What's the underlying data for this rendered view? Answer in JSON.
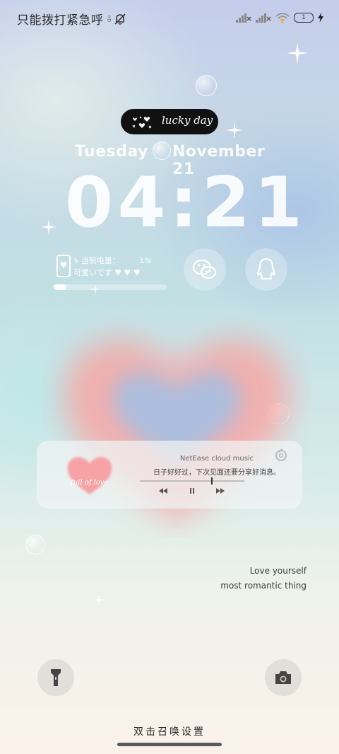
{
  "status_bar": {
    "carrier_text": "只能拨打紧急呼",
    "hd_tag": "HD",
    "battery_level": "1",
    "icons": [
      "mute-bell-icon",
      "signal-x-icon",
      "signal-x-icon",
      "wifi-icon",
      "battery-icon",
      "charging-bolt-icon"
    ]
  },
  "badge": {
    "text": "lucky day"
  },
  "lockscreen": {
    "weekday": "Tuesday",
    "month_day": "November 21",
    "time": "04:21"
  },
  "battery_widget": {
    "label": "当前电量：",
    "percent": "1%",
    "subtitle": "可爱いです ♥ ♥ ♥",
    "level": 0.01
  },
  "shortcuts": {
    "left_icon": "wechat-icon",
    "right_icon": "qq-penguin-icon"
  },
  "music": {
    "app_name": "NetEase cloud music",
    "lyric": "日子好好过，下次见面还要分享好消息。",
    "cover_text": "full of love",
    "progress": 0.68
  },
  "quote": {
    "line1": "Love yourself",
    "line2": "most romantic thing"
  },
  "bottom": {
    "left_icon": "flashlight-icon",
    "right_icon": "camera-icon",
    "hint": "双击召唤设置"
  },
  "colors": {
    "heart_pink": "#f7a6a4",
    "heart_blue": "#a9bfe0",
    "badge_bg": "#111111"
  }
}
